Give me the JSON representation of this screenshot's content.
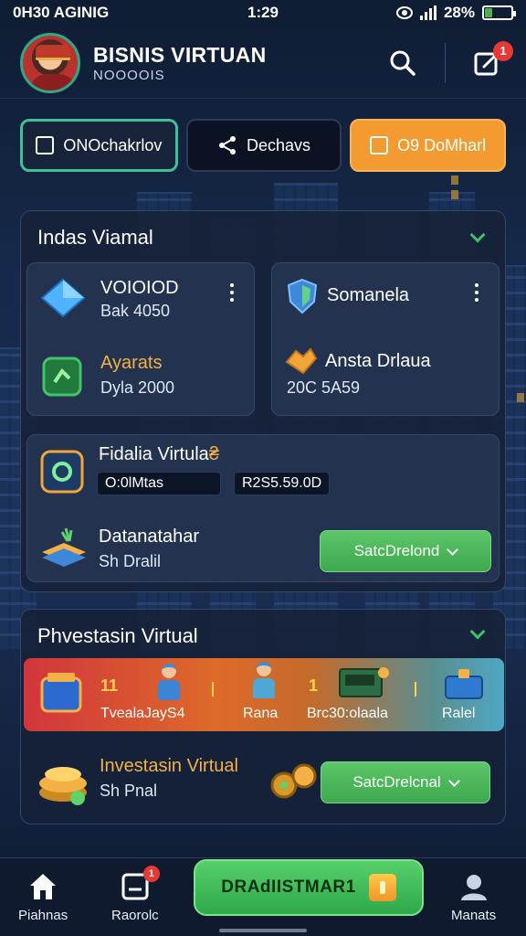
{
  "status": {
    "left": "0H30 AGINIG",
    "center": "1:29",
    "battery": "28%",
    "battery_level": 0.28
  },
  "header": {
    "title": "BISNIS VIRTUAN",
    "subtitle": "NOOOOIS",
    "notification_count": "1"
  },
  "tabs": [
    {
      "label": "ONOchakrlov"
    },
    {
      "label": "Dechavs"
    },
    {
      "label": "O9 DoMharl"
    }
  ],
  "panel1": {
    "title": "Indas Viamal",
    "card_left": {
      "item1": {
        "label": "VOIOIOD",
        "value": "Bak 4050"
      },
      "item2": {
        "label": "Ayarats",
        "value": "Dyla 2000"
      }
    },
    "card_right": {
      "item1": {
        "label": "Somanela"
      },
      "item2": {
        "label": "Ansta Drlaua",
        "value": "20C 5A59"
      }
    },
    "card_wide": {
      "item1": {
        "label": "Fidalia Virtula",
        "suffix": "₴",
        "pill1": "O:0lMtas",
        "pill2": "R2S5.59.0D"
      },
      "item2": {
        "label": "Datanatahar",
        "value": "Sh Dralil",
        "button": "SatcDrelond"
      }
    }
  },
  "panel2": {
    "title": "Phvestasin Virtual",
    "banner": {
      "num1": "11",
      "label1": "TvealaJayS4",
      "label2": "Rana",
      "num2": "1",
      "label3": "Brc30:olaala",
      "label4": "Ralel"
    },
    "item": {
      "label": "Investasin Virtual",
      "value": "Sh Pnal",
      "button": "SatcDrelcnal"
    }
  },
  "bottom_nav": {
    "home": "Piahnas",
    "reports": "Raorolc",
    "cta": "DRAdIISTMAR1",
    "profile": "Manats",
    "reports_badge": "1"
  },
  "colors": {
    "accent_green": "#3fbf9a",
    "orange": "#f39a30",
    "gold": "#f3b146",
    "button_green": "#4bbb5a"
  }
}
